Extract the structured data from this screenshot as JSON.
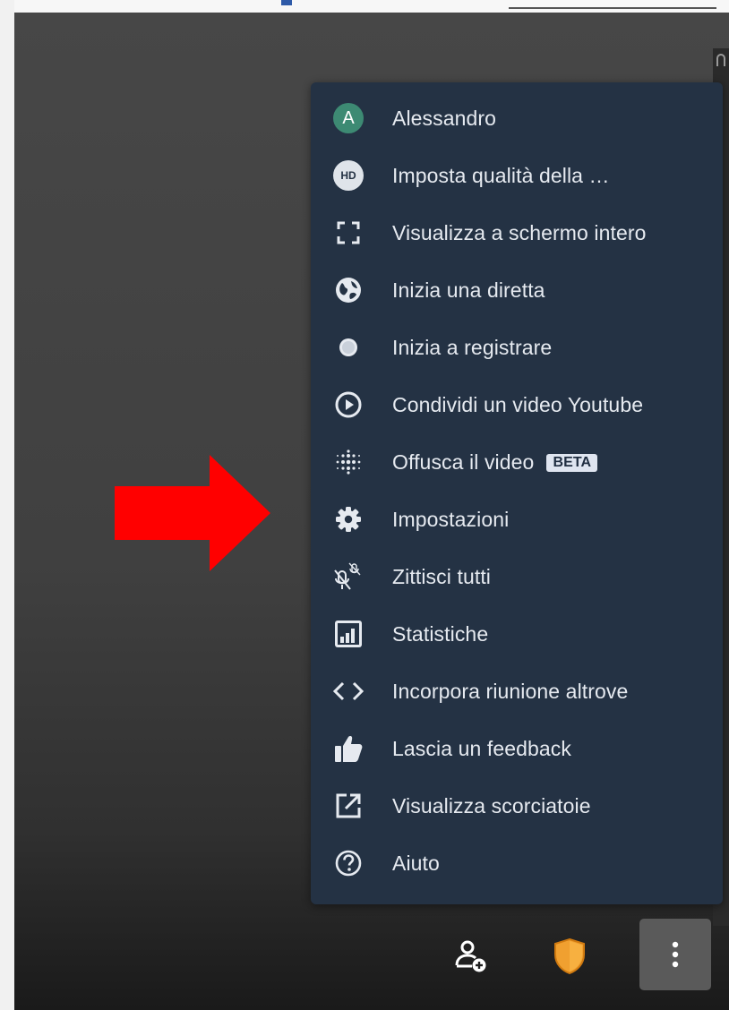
{
  "menu": {
    "items": [
      {
        "icon": "avatar-icon",
        "avatar_letter": "A",
        "label": "Alessandro"
      },
      {
        "icon": "hd-quality-icon",
        "badge_text": "HD",
        "label": "Imposta qualità della …"
      },
      {
        "icon": "fullscreen-icon",
        "label": "Visualizza a schermo intero"
      },
      {
        "icon": "globe-icon",
        "label": "Inizia una diretta"
      },
      {
        "icon": "record-icon",
        "label": "Inizia a registrare"
      },
      {
        "icon": "play-circle-icon",
        "label": "Condividi un video Youtube"
      },
      {
        "icon": "blur-dots-icon",
        "label": "Offusca il video",
        "badge": "BETA"
      },
      {
        "icon": "gear-icon",
        "label": "Impostazioni"
      },
      {
        "icon": "mute-all-icon",
        "label": "Zittisci tutti"
      },
      {
        "icon": "stats-chart-icon",
        "label": "Statistiche"
      },
      {
        "icon": "code-brackets-icon",
        "label": "Incorpora riunione altrove"
      },
      {
        "icon": "thumbs-up-icon",
        "label": "Lascia un feedback"
      },
      {
        "icon": "external-link-icon",
        "label": "Visualizza scorciatoie"
      },
      {
        "icon": "help-icon",
        "label": "Aiuto"
      }
    ]
  },
  "toolbar": {
    "buttons": [
      {
        "icon": "invite-person-icon"
      },
      {
        "icon": "security-shield-icon"
      },
      {
        "icon": "more-vertical-icon"
      }
    ]
  },
  "colors": {
    "menu_bg": "#243244",
    "menu_text": "#e6eaf0",
    "avatar": "#3d8a73",
    "shield": "#f0a030",
    "annotation_arrow": "#ff0000"
  }
}
